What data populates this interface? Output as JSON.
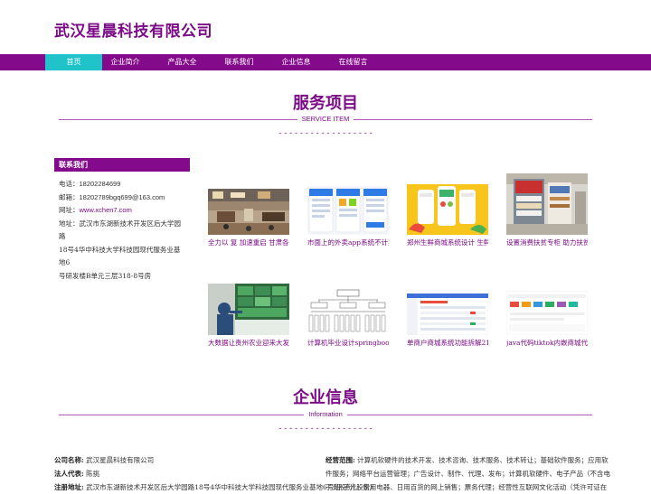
{
  "site": {
    "title": "武汉星晨科技有限公司"
  },
  "nav": [
    "首页",
    "企业简介",
    "产品大全",
    "联系我们",
    "企业信息",
    "在线留言"
  ],
  "services": {
    "title": "服务项目",
    "subtitle": "SERVICE ITEM",
    "dashes": "- - - - - - - - - - - - - - - - - -"
  },
  "contact": {
    "header": "联系我们",
    "phone_label": "电话：",
    "phone": "18202284699",
    "email_label": "邮箱：",
    "email": "18202789bgq699@163.com",
    "web_label": "网址：",
    "web": "www.xchen7.com",
    "addr_label": "地址：",
    "addr_line1": "武汉市东湖新技术开发区后大学园路",
    "addr_line2": "18号4华中科技大学科技园现代服务业基地6",
    "addr_line3": "号研发楼B单元三层318-8号房"
  },
  "products": [
    {
      "caption": "全力以 复 加速重启 甘肃各地"
    },
    {
      "caption": "市面上的外卖app系统不计其"
    },
    {
      "caption": "郑州生鲜商城系统设计 生鲜"
    },
    {
      "caption": "设置消费扶贫专柜 助力扶贫"
    },
    {
      "caption": "大数据让贵州农业迎来大发"
    },
    {
      "caption": "计算机毕业设计springboot天"
    },
    {
      "caption": "单商户商城系统功能拆解21"
    },
    {
      "caption": "java代码tiktok内嵌商城代码"
    }
  ],
  "company_info": {
    "title": "企业信息",
    "subtitle": "Information",
    "dashes": "- - - - - - - - - - - - - - - - - -",
    "name_label": "公司名称:",
    "name": "武汉星晨科技有限公司",
    "rep_label": "法人代表:",
    "rep": "陈挑",
    "addr_label": "注册地址:",
    "addr": "武汉市东湖新技术开发区后大学园路18号4华中科技大学科技园现代服务业基地6号研 子光股份)",
    "scope_label": "经营范围:",
    "scope_line1": "计算机软硬件的技术开发、技术咨询、技术服务、技术转让；基础软件服务；应用软",
    "scope_line2": "件服务；网络平台运营管理；广告设计、制作、代理、发布；计算机软硬件、电子产品（不含电",
    "scope_line3": "子光股份）、家用电器、日用百货的网上销售；票务代理；经营性互联网文化活动（凭许可证在"
  },
  "colors": {
    "brand": "#840a8c",
    "accent": "#1fc3c9",
    "title_purple": "#7b0a86"
  }
}
